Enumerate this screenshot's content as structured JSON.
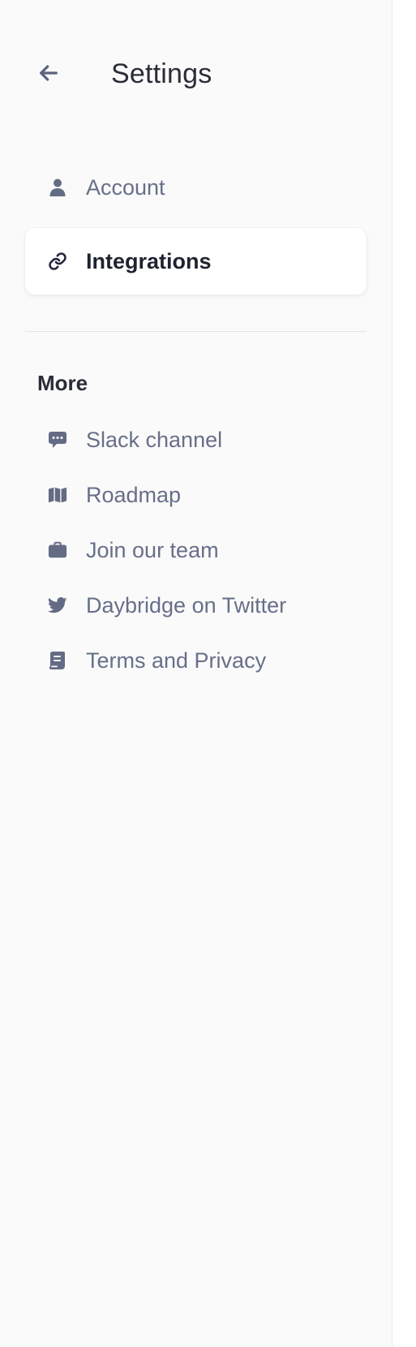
{
  "header": {
    "title": "Settings",
    "back_icon": "arrow-left-icon"
  },
  "nav": {
    "items": [
      {
        "label": "Account",
        "icon": "user-icon",
        "active": false
      },
      {
        "label": "Integrations",
        "icon": "link-icon",
        "active": true
      }
    ]
  },
  "more": {
    "title": "More",
    "items": [
      {
        "label": "Slack channel",
        "icon": "chat-bubble-icon"
      },
      {
        "label": "Roadmap",
        "icon": "map-icon"
      },
      {
        "label": "Join our team",
        "icon": "briefcase-icon"
      },
      {
        "label": "Daybridge on Twitter",
        "icon": "twitter-icon"
      },
      {
        "label": "Terms and Privacy",
        "icon": "document-icon"
      }
    ]
  },
  "colors": {
    "background": "#fafafa",
    "card": "#ffffff",
    "text_primary": "#2a2d36",
    "text_muted": "#676f89",
    "icon": "#646b84"
  }
}
